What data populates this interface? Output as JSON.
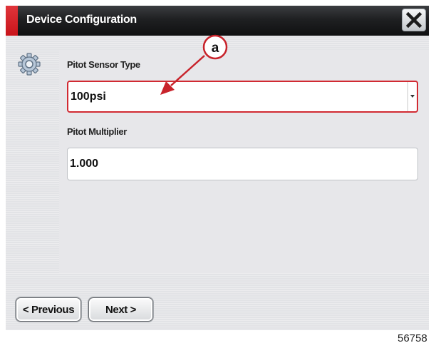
{
  "window": {
    "title": "Device Configuration",
    "close_icon": "close-x-icon",
    "accent_color": "#d11f25"
  },
  "form": {
    "icon": "gear-icon",
    "pitot_sensor_type": {
      "label": "Pitot Sensor Type",
      "value": "100psi"
    },
    "pitot_multiplier": {
      "label": "Pitot Multiplier",
      "value": "1.000"
    }
  },
  "callout": {
    "letter": "a",
    "color": "#c8232b"
  },
  "navigation": {
    "previous_label": "< Previous",
    "next_label": "Next >"
  },
  "figure_number": "56758"
}
